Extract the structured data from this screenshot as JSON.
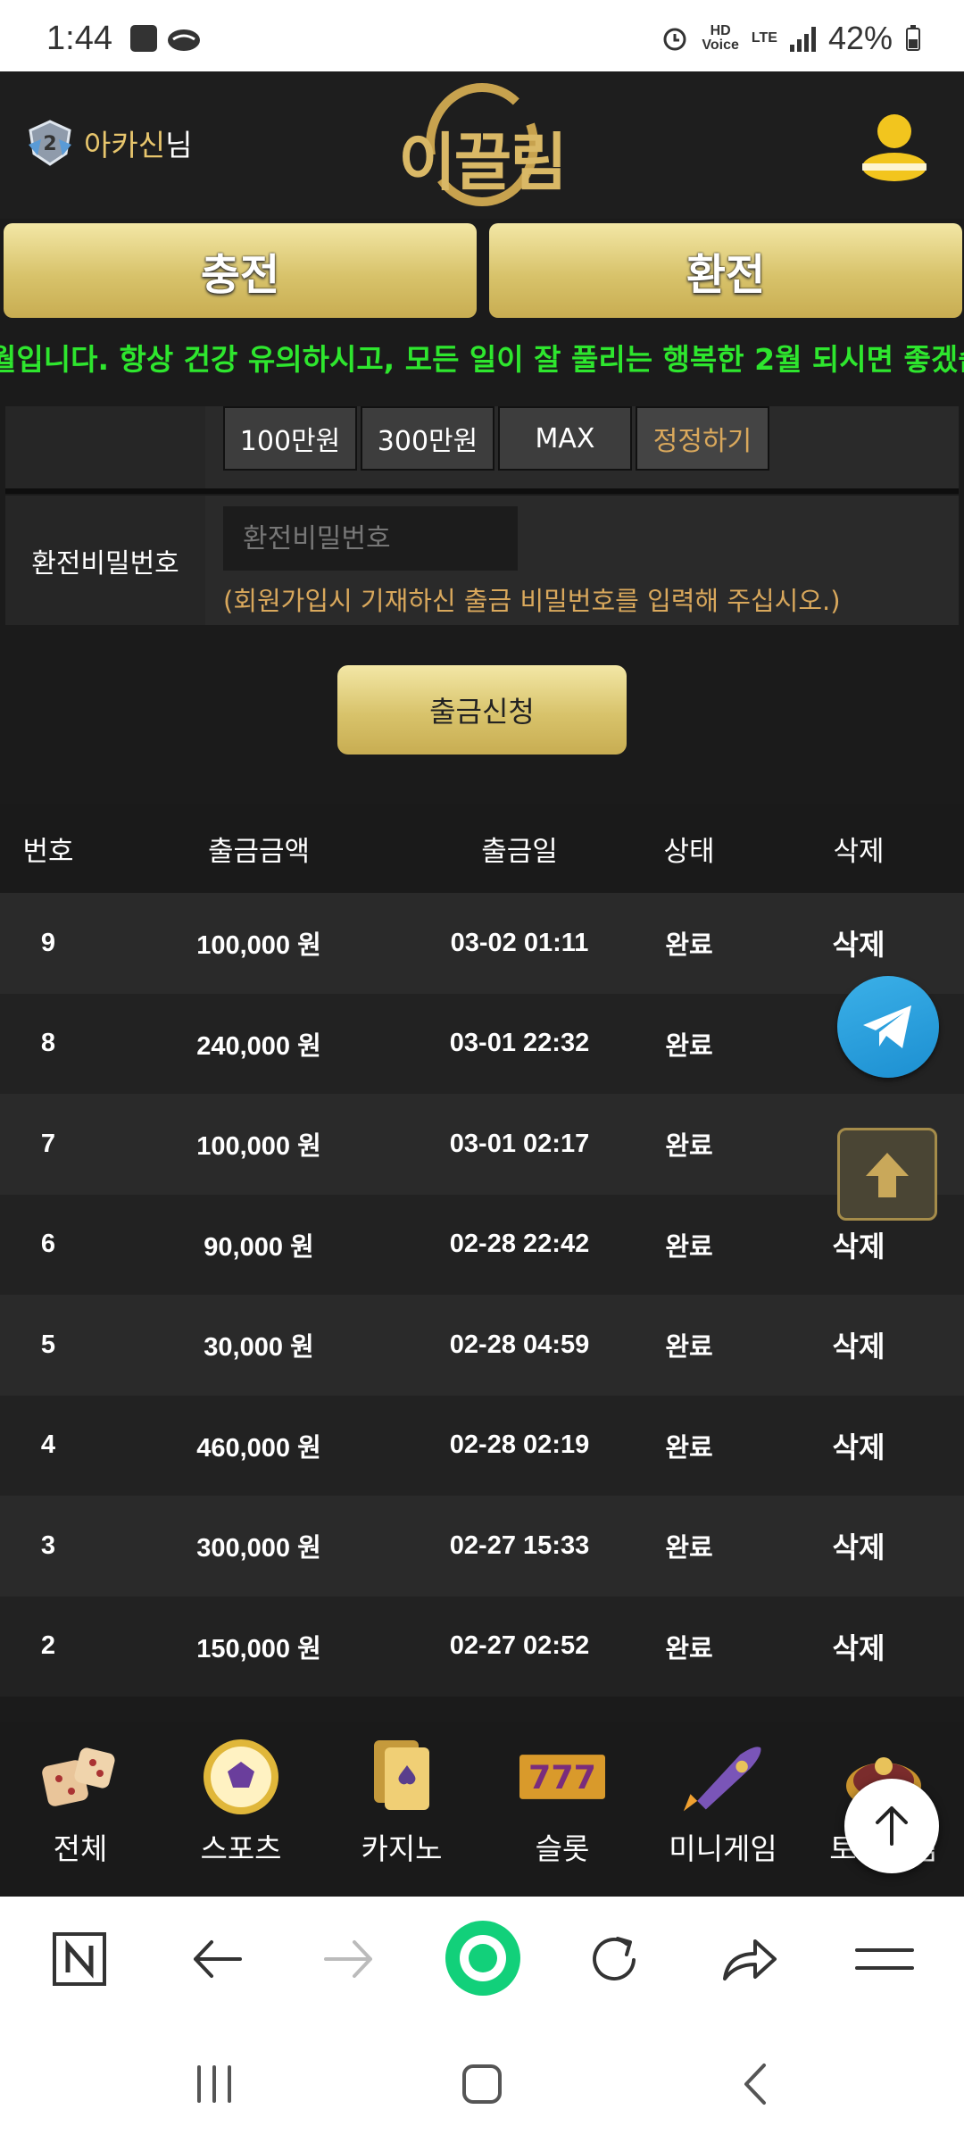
{
  "status": {
    "time": "1:44",
    "battery": "42%",
    "network": "LTE",
    "voice": "HD\nVoice"
  },
  "header": {
    "username": "아카신",
    "suffix": "님",
    "logo": "이끌림",
    "level_badge": "2"
  },
  "top_buttons": {
    "charge": "충전",
    "exchange": "환전"
  },
  "marquee": "월입니다. 항상 건강 유의하시고, 모든 일이 잘 풀리는 행복한 2월 되시면 좋겠습",
  "form": {
    "amounts": [
      "100만원",
      "300만원",
      "MAX"
    ],
    "fix_label": "정정하기",
    "password_label": "환전비밀번호",
    "password_placeholder": "환전비밀번호",
    "hint": "(회원가입시 기재하신 출금 비밀번호를 입력해 주십시오.)",
    "submit": "출금신청"
  },
  "table": {
    "headers": [
      "번호",
      "출금금액",
      "출금일",
      "상태",
      "삭제"
    ],
    "rows": [
      {
        "no": "9",
        "amount": "100,000 원",
        "date": "03-02 01:11",
        "status": "완료",
        "del": "삭제"
      },
      {
        "no": "8",
        "amount": "240,000 원",
        "date": "03-01 22:32",
        "status": "완료",
        "del": ""
      },
      {
        "no": "7",
        "amount": "100,000 원",
        "date": "03-01 02:17",
        "status": "완료",
        "del": ""
      },
      {
        "no": "6",
        "amount": "90,000 원",
        "date": "02-28 22:42",
        "status": "완료",
        "del": "삭제"
      },
      {
        "no": "5",
        "amount": "30,000 원",
        "date": "02-28 04:59",
        "status": "완료",
        "del": "삭제"
      },
      {
        "no": "4",
        "amount": "460,000 원",
        "date": "02-28 02:19",
        "status": "완료",
        "del": "삭제"
      },
      {
        "no": "3",
        "amount": "300,000 원",
        "date": "02-27 15:33",
        "status": "완료",
        "del": "삭제"
      },
      {
        "no": "2",
        "amount": "150,000 원",
        "date": "02-27 02:52",
        "status": "완료",
        "del": "삭제"
      }
    ]
  },
  "game_nav": [
    "전체",
    "스포츠",
    "카지노",
    "슬롯",
    "미니게임",
    "토큰게임"
  ],
  "icons": {
    "all": "dice-icon",
    "sports": "soccer-ball-icon",
    "casino": "playing-cards-icon",
    "slot": "slot-777-icon",
    "mini": "rocket-icon",
    "token": "roulette-icon"
  },
  "colors": {
    "gold": "#d8c36b",
    "notice_green": "#2ee62e",
    "hint_orange": "#d9a85c",
    "bg": "#1b1b1b"
  }
}
